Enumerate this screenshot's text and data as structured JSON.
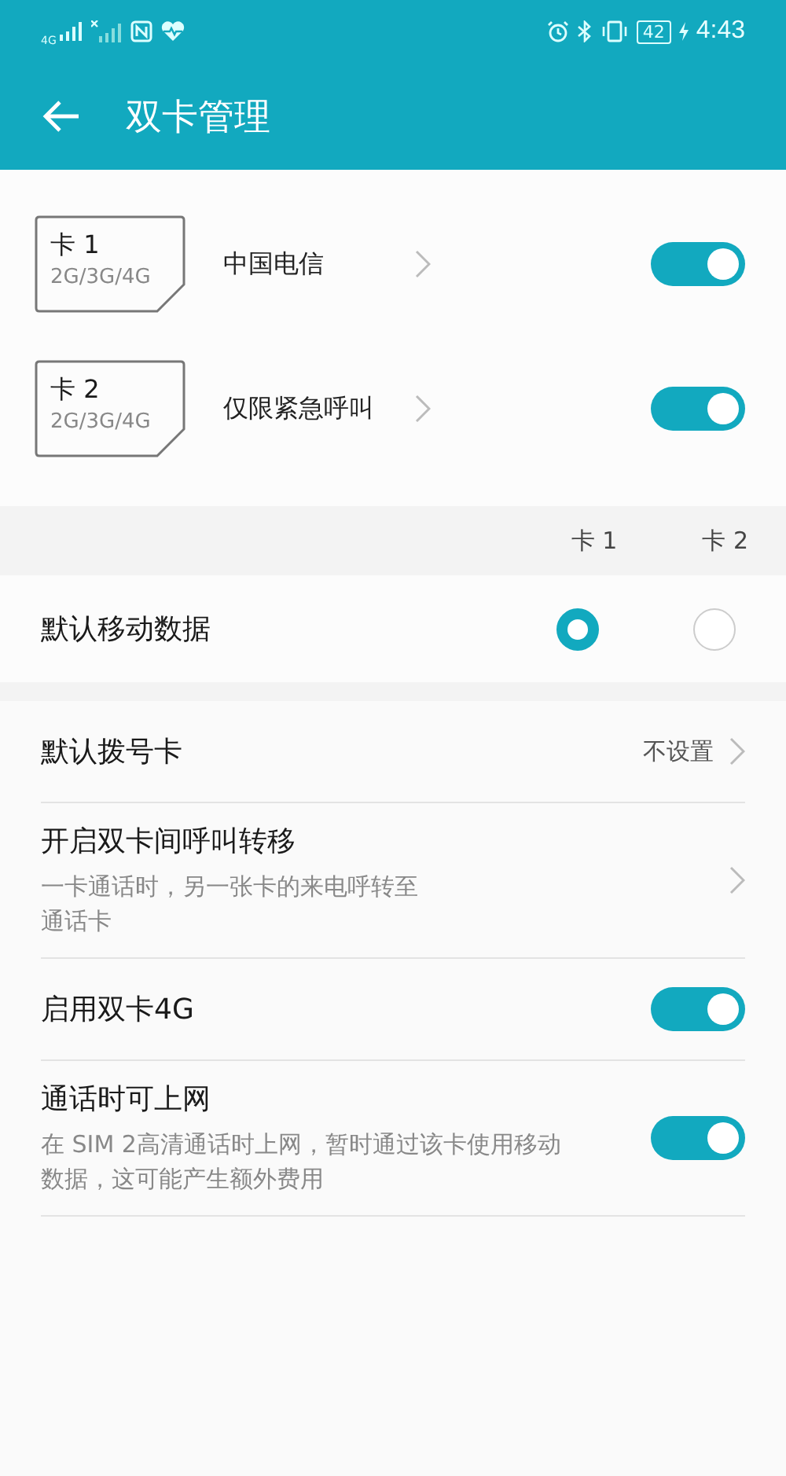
{
  "status_bar": {
    "network": "4G",
    "battery": "42",
    "time": "4:43"
  },
  "app_bar": {
    "title": "双卡管理"
  },
  "sims": [
    {
      "label": "卡 1",
      "bands": "2G/3G/4G",
      "carrier": "中国电信",
      "on": true
    },
    {
      "label": "卡 2",
      "bands": "2G/3G/4G",
      "carrier": "仅限紧急呼叫",
      "on": true
    }
  ],
  "data_columns": [
    "卡 1",
    "卡 2"
  ],
  "default_data": {
    "label": "默认移动数据",
    "options": [
      {
        "selected": true
      },
      {
        "selected": false
      }
    ]
  },
  "settings": [
    {
      "kind": "nav",
      "title": "默认拨号卡",
      "value": "不设置"
    },
    {
      "kind": "nav",
      "title": "开启双卡间呼叫转移",
      "subtitle": "一卡通话时，另一张卡的来电呼转至通话卡"
    },
    {
      "kind": "toggle",
      "title": "启用双卡4G",
      "on": true
    },
    {
      "kind": "toggle",
      "title": "通话时可上网",
      "subtitle": "在 SIM 2高清通话时上网，暂时通过该卡使用移动数据，这可能产生额外费用",
      "on": true
    }
  ]
}
